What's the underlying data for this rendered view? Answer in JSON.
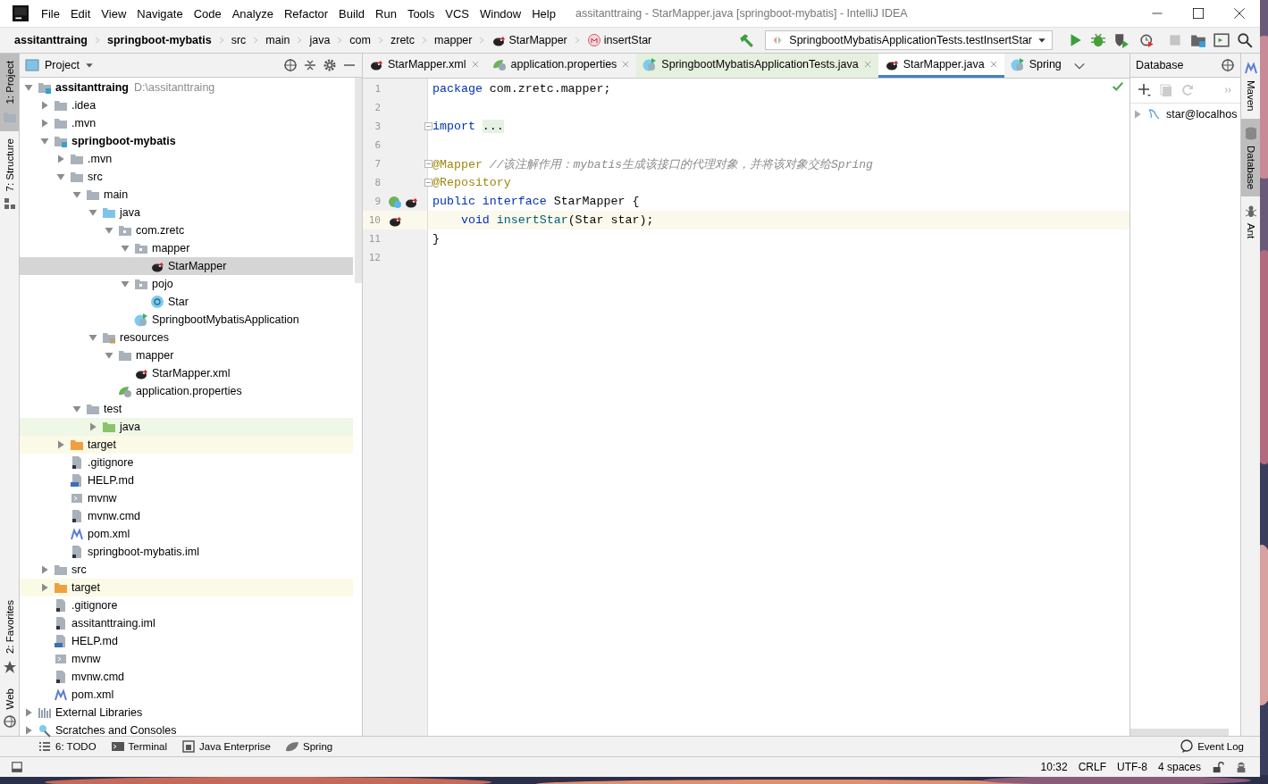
{
  "window": {
    "title": "assitanttraing - StarMapper.java [springboot-mybatis] - IntelliJ IDEA",
    "menu": [
      "File",
      "Edit",
      "View",
      "Navigate",
      "Code",
      "Analyze",
      "Refactor",
      "Build",
      "Run",
      "Tools",
      "VCS",
      "Window",
      "Help"
    ]
  },
  "breadcrumb": [
    {
      "text": "assitanttraing",
      "bold": true
    },
    {
      "text": "springboot-mybatis",
      "bold": true
    },
    {
      "text": "src",
      "bold": false
    },
    {
      "text": "main",
      "bold": false
    },
    {
      "text": "java",
      "bold": false
    },
    {
      "text": "com",
      "bold": false
    },
    {
      "text": "zretc",
      "bold": false
    },
    {
      "text": "mapper",
      "bold": false
    },
    {
      "text": "StarMapper",
      "bold": false,
      "kind": "mybatis"
    },
    {
      "text": "insertStar",
      "bold": false,
      "kind": "method"
    }
  ],
  "run_config": {
    "value": "SpringbootMybatisApplicationTests.testInsertStar"
  },
  "left_stripe": [
    {
      "label": "1: Project",
      "selected": true,
      "kind": "folder"
    },
    {
      "label": "7: Structure",
      "selected": false,
      "kind": "structure"
    },
    {
      "label": "2: Favorites",
      "selected": false,
      "kind": "star"
    },
    {
      "label": "Web",
      "selected": false,
      "kind": "globe"
    }
  ],
  "project": {
    "title": "Project",
    "tree": [
      {
        "name": "assitanttraing",
        "bold": true,
        "hint": "D:\\assitanttraing",
        "kind": "module",
        "expanded": true,
        "children": [
          {
            "name": ".idea",
            "kind": "folder",
            "expanded": false
          },
          {
            "name": ".mvn",
            "kind": "folder",
            "expanded": false
          },
          {
            "name": "springboot-mybatis",
            "bold": true,
            "kind": "module",
            "expanded": true,
            "children": [
              {
                "name": ".mvn",
                "kind": "folder",
                "expanded": false
              },
              {
                "name": "src",
                "kind": "folder",
                "expanded": true,
                "children": [
                  {
                    "name": "main",
                    "kind": "folder",
                    "expanded": true,
                    "children": [
                      {
                        "name": "java",
                        "kind": "source",
                        "expanded": true,
                        "children": [
                          {
                            "name": "com.zretc",
                            "kind": "package",
                            "expanded": true,
                            "children": [
                              {
                                "name": "mapper",
                                "kind": "package",
                                "expanded": true,
                                "children": [
                                  {
                                    "name": "StarMapper",
                                    "kind": "mybatis",
                                    "selected": true
                                  }
                                ]
                              },
                              {
                                "name": "pojo",
                                "kind": "package",
                                "expanded": true,
                                "children": [
                                  {
                                    "name": "Star",
                                    "kind": "class",
                                    "selected": false
                                  }
                                ]
                              },
                              {
                                "name": "SpringbootMybatisApplication",
                                "kind": "spring-class",
                                "selected": false
                              }
                            ]
                          }
                        ]
                      },
                      {
                        "name": "resources",
                        "kind": "resources",
                        "expanded": true,
                        "children": [
                          {
                            "name": "mapper",
                            "kind": "folder",
                            "expanded": true,
                            "children": [
                              {
                                "name": "StarMapper.xml",
                                "kind": "mybatis",
                                "selected": false
                              }
                            ]
                          },
                          {
                            "name": "application.properties",
                            "kind": "spring-props",
                            "selected": false
                          }
                        ]
                      }
                    ]
                  },
                  {
                    "name": "test",
                    "kind": "folder",
                    "expanded": true,
                    "children": [
                      {
                        "name": "java",
                        "kind": "test-source",
                        "expanded": false,
                        "color": "#eff7e6"
                      }
                    ]
                  }
                ]
              },
              {
                "name": "target",
                "kind": "excluded",
                "expanded": false,
                "color": "#fbfae6"
              },
              {
                "name": ".gitignore",
                "kind": "text",
                "selected": false
              },
              {
                "name": "HELP.md",
                "kind": "md",
                "selected": false
              },
              {
                "name": "mvnw",
                "kind": "script",
                "selected": false
              },
              {
                "name": "mvnw.cmd",
                "kind": "text",
                "selected": false
              },
              {
                "name": "pom.xml",
                "kind": "maven",
                "selected": false
              },
              {
                "name": "springboot-mybatis.iml",
                "kind": "text",
                "selected": false
              }
            ]
          },
          {
            "name": "src",
            "kind": "folder",
            "expanded": false
          },
          {
            "name": "target",
            "kind": "excluded",
            "expanded": false,
            "color": "#fbfae6"
          },
          {
            "name": ".gitignore",
            "kind": "text",
            "selected": false
          },
          {
            "name": "assitanttraing.iml",
            "kind": "text",
            "selected": false
          },
          {
            "name": "HELP.md",
            "kind": "md",
            "selected": false
          },
          {
            "name": "mvnw",
            "kind": "script",
            "selected": false
          },
          {
            "name": "mvnw.cmd",
            "kind": "text",
            "selected": false
          },
          {
            "name": "pom.xml",
            "kind": "maven",
            "selected": false
          }
        ]
      },
      {
        "name": "External Libraries",
        "kind": "libraries",
        "expanded": false
      },
      {
        "name": "Scratches and Consoles",
        "kind": "scratches",
        "expanded": false
      }
    ]
  },
  "editor": {
    "tabs": [
      {
        "label": "StarMapper.xml",
        "kind": "mybatis",
        "selected": false,
        "closable": true
      },
      {
        "label": "application.properties",
        "kind": "spring-props",
        "selected": false,
        "closable": true
      },
      {
        "label": "SpringbootMybatisApplicationTests.java",
        "kind": "spring-class",
        "selected": false,
        "closable": true,
        "color": "#e6f0df"
      },
      {
        "label": "StarMapper.java",
        "kind": "mybatis",
        "selected": true,
        "closable": true
      },
      {
        "label": "Spring",
        "kind": "spring-class",
        "selected": false,
        "closable": false
      }
    ],
    "lines": [
      {
        "number": "1",
        "tokens": [
          {
            "text": "package ",
            "kind": "keyword"
          },
          {
            "text": "com.zretc.mapper;",
            "kind": "plain"
          }
        ]
      },
      {
        "number": "2"
      },
      {
        "number": "3",
        "fold": true,
        "tokens": [
          {
            "text": "import ",
            "kind": "keyword"
          },
          {
            "text": "...",
            "kind": "folded"
          }
        ]
      },
      {
        "number": "6"
      },
      {
        "number": "7",
        "fold": true,
        "tokens": [
          {
            "text": "@Mapper ",
            "kind": "annotation"
          },
          {
            "text": "//该注解作用：mybatis生成该接口的代理对象，并将该对象交给Spring",
            "kind": "comment"
          }
        ]
      },
      {
        "number": "8",
        "fold": true,
        "tokens": [
          {
            "text": "@Repository",
            "kind": "annotation"
          }
        ]
      },
      {
        "number": "9",
        "gutter": [
          {
            "kind": "spring-bean"
          },
          {
            "kind": "mybatis"
          }
        ],
        "tokens": [
          {
            "text": "public ",
            "kind": "keyword"
          },
          {
            "text": "interface ",
            "kind": "keyword"
          },
          {
            "text": "StarMapper {",
            "kind": "plain"
          }
        ]
      },
      {
        "number": "10",
        "current": true,
        "gutter": [
          {
            "kind": "mybatis"
          }
        ],
        "tokens": [
          {
            "text": "    void ",
            "kind": "keyword"
          },
          {
            "text": "insertStar",
            "kind": "method"
          },
          {
            "text": "(Star star);",
            "kind": "plain"
          }
        ]
      },
      {
        "number": "11",
        "tokens": [
          {
            "text": "}",
            "kind": "plain"
          }
        ]
      },
      {
        "number": "12"
      }
    ]
  },
  "database": {
    "title": "Database",
    "tree": [
      {
        "name": "star@localhos",
        "expanded": false
      }
    ]
  },
  "right_stripe": [
    {
      "label": "Maven",
      "selected": false,
      "kind": "maven"
    },
    {
      "label": "Database",
      "selected": true,
      "kind": "database"
    },
    {
      "label": "Ant",
      "selected": false,
      "kind": "ant"
    }
  ],
  "tool_windows": {
    "left": [
      {
        "label": "6: TODO",
        "kind": "list"
      },
      {
        "label": "Terminal",
        "kind": "terminal"
      },
      {
        "label": "Java Enterprise",
        "kind": "enterprise"
      },
      {
        "label": "Spring",
        "kind": "spring"
      }
    ],
    "right": [
      {
        "label": "Event Log",
        "kind": "log"
      }
    ]
  },
  "status_bar": [
    "10:32",
    "CRLF",
    "UTF-8",
    "4 spaces"
  ]
}
